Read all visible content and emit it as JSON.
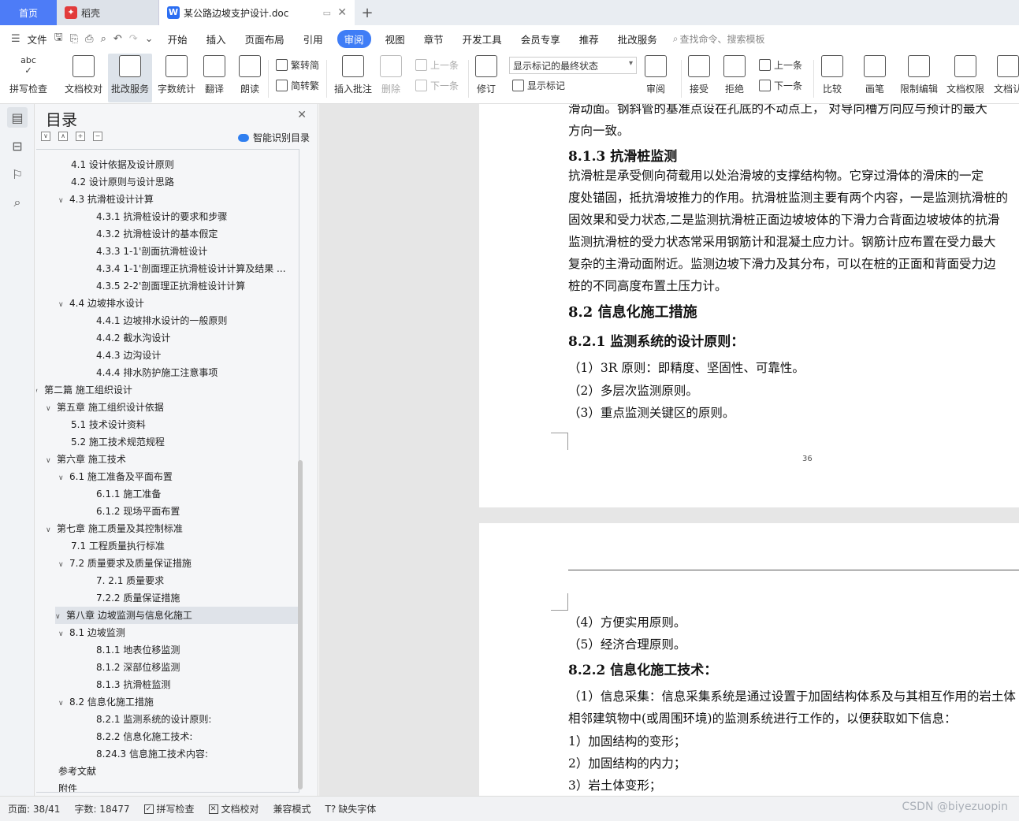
{
  "tabs": {
    "home": "首页",
    "daoke": "稻壳",
    "doc": "某公路边坡支护设计.doc"
  },
  "menu": {
    "file": "文件",
    "items": [
      "开始",
      "插入",
      "页面布局",
      "引用",
      "审阅",
      "视图",
      "章节",
      "开发工具",
      "会员专享",
      "推荐",
      "批改服务"
    ],
    "active": "审阅",
    "search": "查找命令、搜索模板"
  },
  "ribbon": {
    "spell": "拼写检查",
    "proof": "文档校对",
    "correct": "批改服务",
    "wordcount": "字数统计",
    "translate": "翻译",
    "read": "朗读",
    "t2s": "繁转简",
    "s2t": "简转繁",
    "insert_comment": "插入批注",
    "delete": "删除",
    "prev": "上一条",
    "next": "下一条",
    "track": "修订",
    "markup_state": "显示标记的最终状态",
    "show_markup": "显示标记",
    "review": "审阅",
    "accept": "接受",
    "reject": "拒绝",
    "prev2": "上一条",
    "next2": "下一条",
    "compare": "比较",
    "ink": "画笔",
    "restrict": "限制编辑",
    "doc_perm": "文档权限",
    "doc_cert": "文档认"
  },
  "toc": {
    "title": "目录",
    "smart": "智能识别目录",
    "items": [
      {
        "text": "4.1 设计依据及设计原则",
        "level": 3,
        "caret": ""
      },
      {
        "text": "4.2  设计原则与设计思路",
        "level": 3,
        "caret": ""
      },
      {
        "text": "4.3  抗滑桩设计计算",
        "level": 3,
        "caret": "∨"
      },
      {
        "text": "4.3.1 抗滑桩设计的要求和步骤",
        "level": 4,
        "caret": ""
      },
      {
        "text": "4.3.2 抗滑桩设计的基本假定",
        "level": 4,
        "caret": ""
      },
      {
        "text": "4.3.3 1-1'剖面抗滑桩设计",
        "level": 4,
        "caret": ""
      },
      {
        "text": "4.3.4    1-1'剖面理正抗滑桩设计计算及结果 ...",
        "level": 4,
        "caret": ""
      },
      {
        "text": "4.3.5 2-2'剖面理正抗滑桩设计计算",
        "level": 4,
        "caret": ""
      },
      {
        "text": "4.4  边坡排水设计",
        "level": 3,
        "caret": "∨"
      },
      {
        "text": "4.4.1 边坡排水设计的一般原则",
        "level": 4,
        "caret": ""
      },
      {
        "text": "4.4.2 截水沟设计",
        "level": 4,
        "caret": ""
      },
      {
        "text": "4.4.3 边沟设计",
        "level": 4,
        "caret": ""
      },
      {
        "text": "4.4.4 排水防护施工注意事项",
        "level": 4,
        "caret": ""
      },
      {
        "text": "第二篇  施工组织设计",
        "level": 1,
        "caret": "∨"
      },
      {
        "text": "第五章    施工组织设计依据",
        "level": 2,
        "caret": "∨"
      },
      {
        "text": "5.1  技术设计资料",
        "level": 3,
        "caret": ""
      },
      {
        "text": "5.2  施工技术规范规程",
        "level": 3,
        "caret": ""
      },
      {
        "text": "第六章    施工技术",
        "level": 2,
        "caret": "∨"
      },
      {
        "text": "6.1  施工准备及平面布置",
        "level": 3,
        "caret": "∨"
      },
      {
        "text": "6.1.1 施工准备",
        "level": 4,
        "caret": ""
      },
      {
        "text": "6.1.2 现场平面布置",
        "level": 4,
        "caret": ""
      },
      {
        "text": "第七章    施工质量及其控制标准",
        "level": 2,
        "caret": "∨"
      },
      {
        "text": "7.1 工程质量执行标准",
        "level": 3,
        "caret": ""
      },
      {
        "text": "7.2  质量要求及质量保证措施",
        "level": 3,
        "caret": "∨"
      },
      {
        "text": "7. 2.1 质量要求",
        "level": 4,
        "caret": ""
      },
      {
        "text": "7.2.2  质量保证措施",
        "level": 4,
        "caret": ""
      },
      {
        "text": "第八章    边坡监测与信息化施工",
        "level": 2,
        "caret": "∨",
        "selected": true
      },
      {
        "text": "8.1  边坡监测",
        "level": 3,
        "caret": "∨"
      },
      {
        "text": "8.1.1 地表位移监测",
        "level": 4,
        "caret": ""
      },
      {
        "text": "8.1.2 深部位移监测",
        "level": 4,
        "caret": ""
      },
      {
        "text": "8.1.3 抗滑桩监测",
        "level": 4,
        "caret": ""
      },
      {
        "text": "8.2 信息化施工措施",
        "level": 3,
        "caret": "∨"
      },
      {
        "text": "8.2.1 监测系统的设计原则:",
        "level": 4,
        "caret": ""
      },
      {
        "text": "8.2.2 信息化施工技术:",
        "level": 4,
        "caret": ""
      },
      {
        "text": "8.24.3 信息施工技术内容:",
        "level": 4,
        "caret": ""
      },
      {
        "text": "参考文献",
        "level": 2,
        "caret": ""
      },
      {
        "text": "附件",
        "level": 2,
        "caret": ""
      }
    ]
  },
  "page1": {
    "lines": [
      {
        "text": "滑动面。钢斜管的基准点设在孔底的不动点上，    对导向槽方向应与预计的最大",
        "cls": ""
      },
      {
        "text": "方向一致。",
        "cls": ""
      },
      {
        "text": "8.1.3 抗滑桩监测",
        "cls": "h"
      },
      {
        "text": "    抗滑桩是承受侧向荷载用以处治滑坡的支撑结构物。它穿过滑体的滑床的一定",
        "cls": ""
      },
      {
        "text": "度处锚固，抵抗滑坡推力的作用。抗滑桩监测主要有两个内容，一是监测抗滑桩的",
        "cls": ""
      },
      {
        "text": "固效果和受力状态,二是监测抗滑桩正面边坡坡体的下滑力合背面边坡坡体的抗滑",
        "cls": ""
      },
      {
        "text": "监测抗滑桩的受力状态常采用钢筋计和混凝土应力计。钢筋计应布置在受力最大",
        "cls": ""
      },
      {
        "text": "复杂的主滑动面附近。监测边坡下滑力及其分布，可以在桩的正面和背面受力边",
        "cls": ""
      },
      {
        "text": "桩的不同高度布置土压力计。",
        "cls": ""
      },
      {
        "text": "8.2 信息化施工措施",
        "cls": "h2"
      },
      {
        "text": "8.2.1 监测系统的设计原则：",
        "cls": "h"
      },
      {
        "text": "（1）3R 原则：即精度、坚固性、可靠性。",
        "cls": ""
      },
      {
        "text": "（2）多层次监测原则。",
        "cls": ""
      },
      {
        "text": "（3）重点监测关键区的原则。",
        "cls": ""
      }
    ],
    "page_number": "36"
  },
  "page2": {
    "lines": [
      {
        "text": "（4）方便实用原则。",
        "cls": ""
      },
      {
        "text": "（5）经济合理原则。",
        "cls": ""
      },
      {
        "text": "8.2.2 信息化施工技术：",
        "cls": "h"
      },
      {
        "text": "（1）信息采集：信息采集系统是通过设置于加固结构体系及与其相互作用的岩土体",
        "cls": ""
      },
      {
        "text": "相邻建筑物中(或周围环境)的监测系统进行工作的，以便获取如下信息：",
        "cls": ""
      },
      {
        "text": "    1）加固结构的变形；",
        "cls": ""
      },
      {
        "text": "    2）加固结构的内力；",
        "cls": ""
      },
      {
        "text": "    3）岩土体变形；",
        "cls": ""
      }
    ]
  },
  "status": {
    "page": "页面: 38/41",
    "words": "字数: 18477",
    "spell": "拼写检查",
    "proof": "文档校对",
    "compat": "兼容模式",
    "missing_font": "缺失字体",
    "watermark": "CSDN @biyezuopin"
  }
}
